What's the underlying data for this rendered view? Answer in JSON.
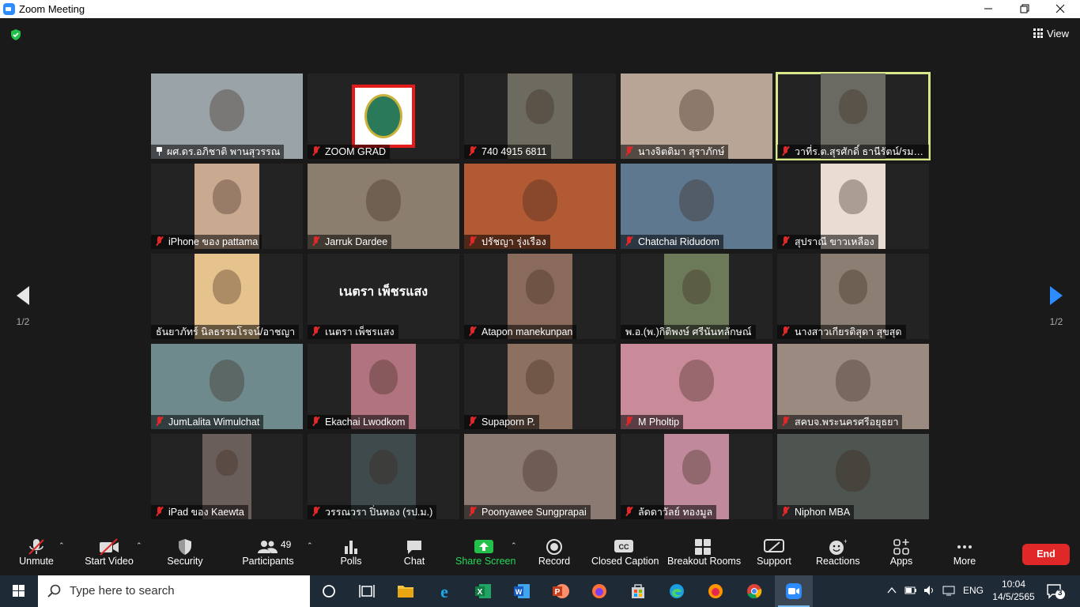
{
  "window": {
    "title": "Zoom Meeting"
  },
  "header": {
    "view_label": "View"
  },
  "pagination": {
    "left_page": "1/2",
    "right_page": "1/2"
  },
  "participants": [
    {
      "name": "ผศ.ดร.อภิชาติ พานสุวรรณ",
      "muted": false,
      "pinned": true,
      "bg": "#9aa3a8",
      "video_w": 192
    },
    {
      "name": "ZOOM GRAD",
      "muted": true,
      "bg": "#ffffff",
      "video_w": 80,
      "logo": true
    },
    {
      "name": "740 4915 6811",
      "muted": true,
      "bg": "#6d6a60",
      "video_w": 82
    },
    {
      "name": "นางจิตติมา สุราภักษ์",
      "muted": true,
      "bg": "#b9a596",
      "video_w": 192
    },
    {
      "name": "วาที่ร.ต.สุรศักดิ์ ธานีรัตน์/รม.อา...",
      "muted": true,
      "bg": "#6a6a62",
      "video_w": 82,
      "active": true
    },
    {
      "name": "iPhone ของ pattama",
      "muted": true,
      "bg": "#c9a990",
      "video_w": 82
    },
    {
      "name": "Jarruk Dardee",
      "muted": true,
      "bg": "#8c7e6f",
      "video_w": 192
    },
    {
      "name": "ปรัชญา รุ่งเรือง",
      "muted": true,
      "bg": "#b25a34",
      "video_w": 192
    },
    {
      "name": "Chatchai Ridudom",
      "muted": true,
      "bg": "#5e7890",
      "video_w": 192
    },
    {
      "name": "สุปราณี ขาวเหลือง",
      "muted": true,
      "bg": "#e9dcd2",
      "video_w": 82
    },
    {
      "name": "ธันยาภัทร์ นิลธรรมโรจน์/อาชญา",
      "muted": false,
      "bg": "#e6c28c",
      "video_w": 82
    },
    {
      "name": "เนตรา เพ็ชรแสง",
      "muted": true,
      "bg": "#232323",
      "video_w": 0,
      "name_only": "เนตรา เพ็ชรแสง"
    },
    {
      "name": "Atapon manekunpan",
      "muted": true,
      "bg": "#8a6a5a",
      "video_w": 82
    },
    {
      "name": "พ.อ.(พ.)กิติพงษ์ ศรีนันทลักษณ์",
      "muted": false,
      "bg": "#6c7a5a",
      "video_w": 82
    },
    {
      "name": "นางสาวเกียรติสุดา สุขสุด",
      "muted": true,
      "bg": "#8a7f72",
      "video_w": 82
    },
    {
      "name": "JumLalita Wimulchat",
      "muted": true,
      "bg": "#6e8a8c",
      "video_w": 192
    },
    {
      "name": "Ekachai Lwodkom",
      "muted": true,
      "bg": "#b0737f",
      "video_w": 82
    },
    {
      "name": "Supaporn P.",
      "muted": true,
      "bg": "#8c7060",
      "video_w": 82
    },
    {
      "name": "M Pholtip",
      "muted": true,
      "bg": "#c98a9a",
      "video_w": 192
    },
    {
      "name": "สคบจ.พระนครศรีอยุธยา",
      "muted": true,
      "bg": "#9a8a80",
      "video_w": 192
    },
    {
      "name": "iPad ของ Kaewta",
      "muted": true,
      "bg": "#6a5e5a",
      "video_w": 62
    },
    {
      "name": "วรรณวรา ปิ่นทอง (รป.ม.)",
      "muted": true,
      "bg": "#3e4a4c",
      "video_w": 82
    },
    {
      "name": "Poonyawee Sungprapai",
      "muted": true,
      "bg": "#8a7a72",
      "video_w": 192
    },
    {
      "name": "ลัดดาวัลย์ ทองมูล",
      "muted": true,
      "bg": "#c08a9c",
      "video_w": 82
    },
    {
      "name": "Niphon MBA",
      "muted": true,
      "bg": "#4e5450",
      "video_w": 192
    }
  ],
  "toolbar": {
    "unmute": "Unmute",
    "start_video": "Start Video",
    "security": "Security",
    "participants": "Participants",
    "participant_count": "49",
    "polls": "Polls",
    "chat": "Chat",
    "share_screen": "Share Screen",
    "record": "Record",
    "closed_caption": "Closed Caption",
    "breakout_rooms": "Breakout Rooms",
    "support": "Support",
    "reactions": "Reactions",
    "apps": "Apps",
    "more": "More",
    "end": "End"
  },
  "taskbar": {
    "search_placeholder": "Type here to search",
    "language": "ENG",
    "time": "10:04",
    "date": "14/5/2565",
    "notification_count": "3"
  },
  "colors": {
    "share_green": "#23d959",
    "end_red": "#e02828",
    "active_speaker": "#d9e68a",
    "arrow_blue": "#2d8cff"
  }
}
